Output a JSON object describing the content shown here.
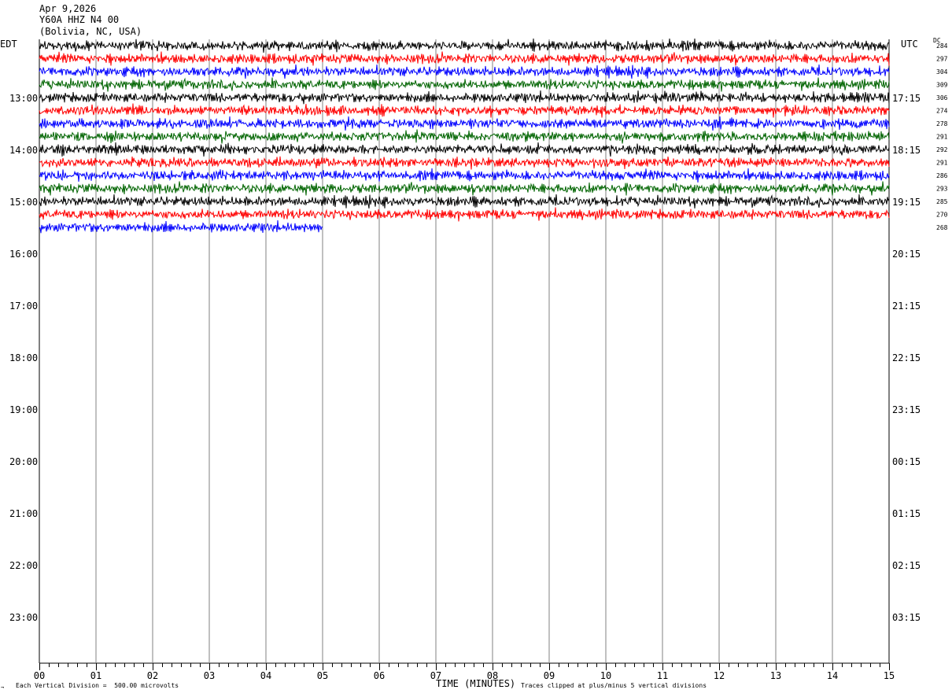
{
  "header": {
    "date": "Apr 9,2026",
    "station": "Y60A HHZ N4 00",
    "location": "(Bolivia, NC, USA)"
  },
  "timezones": {
    "left": "EDT",
    "right": "UTC"
  },
  "dc_label": "DC",
  "footer": {
    "scale": "Each Vertical Division =  500.00 microvolts",
    "clip": "Traces clipped at plus/minus 5 vertical divisions",
    "mark": "¬"
  },
  "chart_data": {
    "type": "line",
    "title": "",
    "xlabel": "TIME (MINUTES)",
    "ylabel": "",
    "xlim": [
      0,
      15
    ],
    "x_ticks": [
      "00",
      "01",
      "02",
      "03",
      "04",
      "05",
      "06",
      "07",
      "08",
      "09",
      "10",
      "11",
      "12",
      "13",
      "14",
      "15"
    ],
    "left_hour_labels": [
      "13:00",
      "14:00",
      "15:00",
      "16:00",
      "17:00",
      "18:00",
      "19:00",
      "20:00",
      "21:00",
      "22:00",
      "23:00"
    ],
    "right_hour_labels": [
      "17:15",
      "18:15",
      "19:15",
      "20:15",
      "21:15",
      "22:15",
      "23:15",
      "00:15",
      "01:15",
      "02:15",
      "03:15"
    ],
    "trace_colors": [
      "#000000",
      "#ff0000",
      "#0000ff",
      "#006400"
    ],
    "series": [
      {
        "dc": "284",
        "duration_min": 15
      },
      {
        "dc": "297",
        "duration_min": 15
      },
      {
        "dc": "304",
        "duration_min": 15
      },
      {
        "dc": "309",
        "duration_min": 15
      },
      {
        "dc": "306",
        "duration_min": 15
      },
      {
        "dc": "274",
        "duration_min": 15
      },
      {
        "dc": "278",
        "duration_min": 15
      },
      {
        "dc": "291",
        "duration_min": 15
      },
      {
        "dc": "292",
        "duration_min": 15
      },
      {
        "dc": "291",
        "duration_min": 15
      },
      {
        "dc": "286",
        "duration_min": 15
      },
      {
        "dc": "293",
        "duration_min": 15
      },
      {
        "dc": "285",
        "duration_min": 15
      },
      {
        "dc": "270",
        "duration_min": 15
      },
      {
        "dc": "268",
        "duration_min": 5
      }
    ]
  }
}
